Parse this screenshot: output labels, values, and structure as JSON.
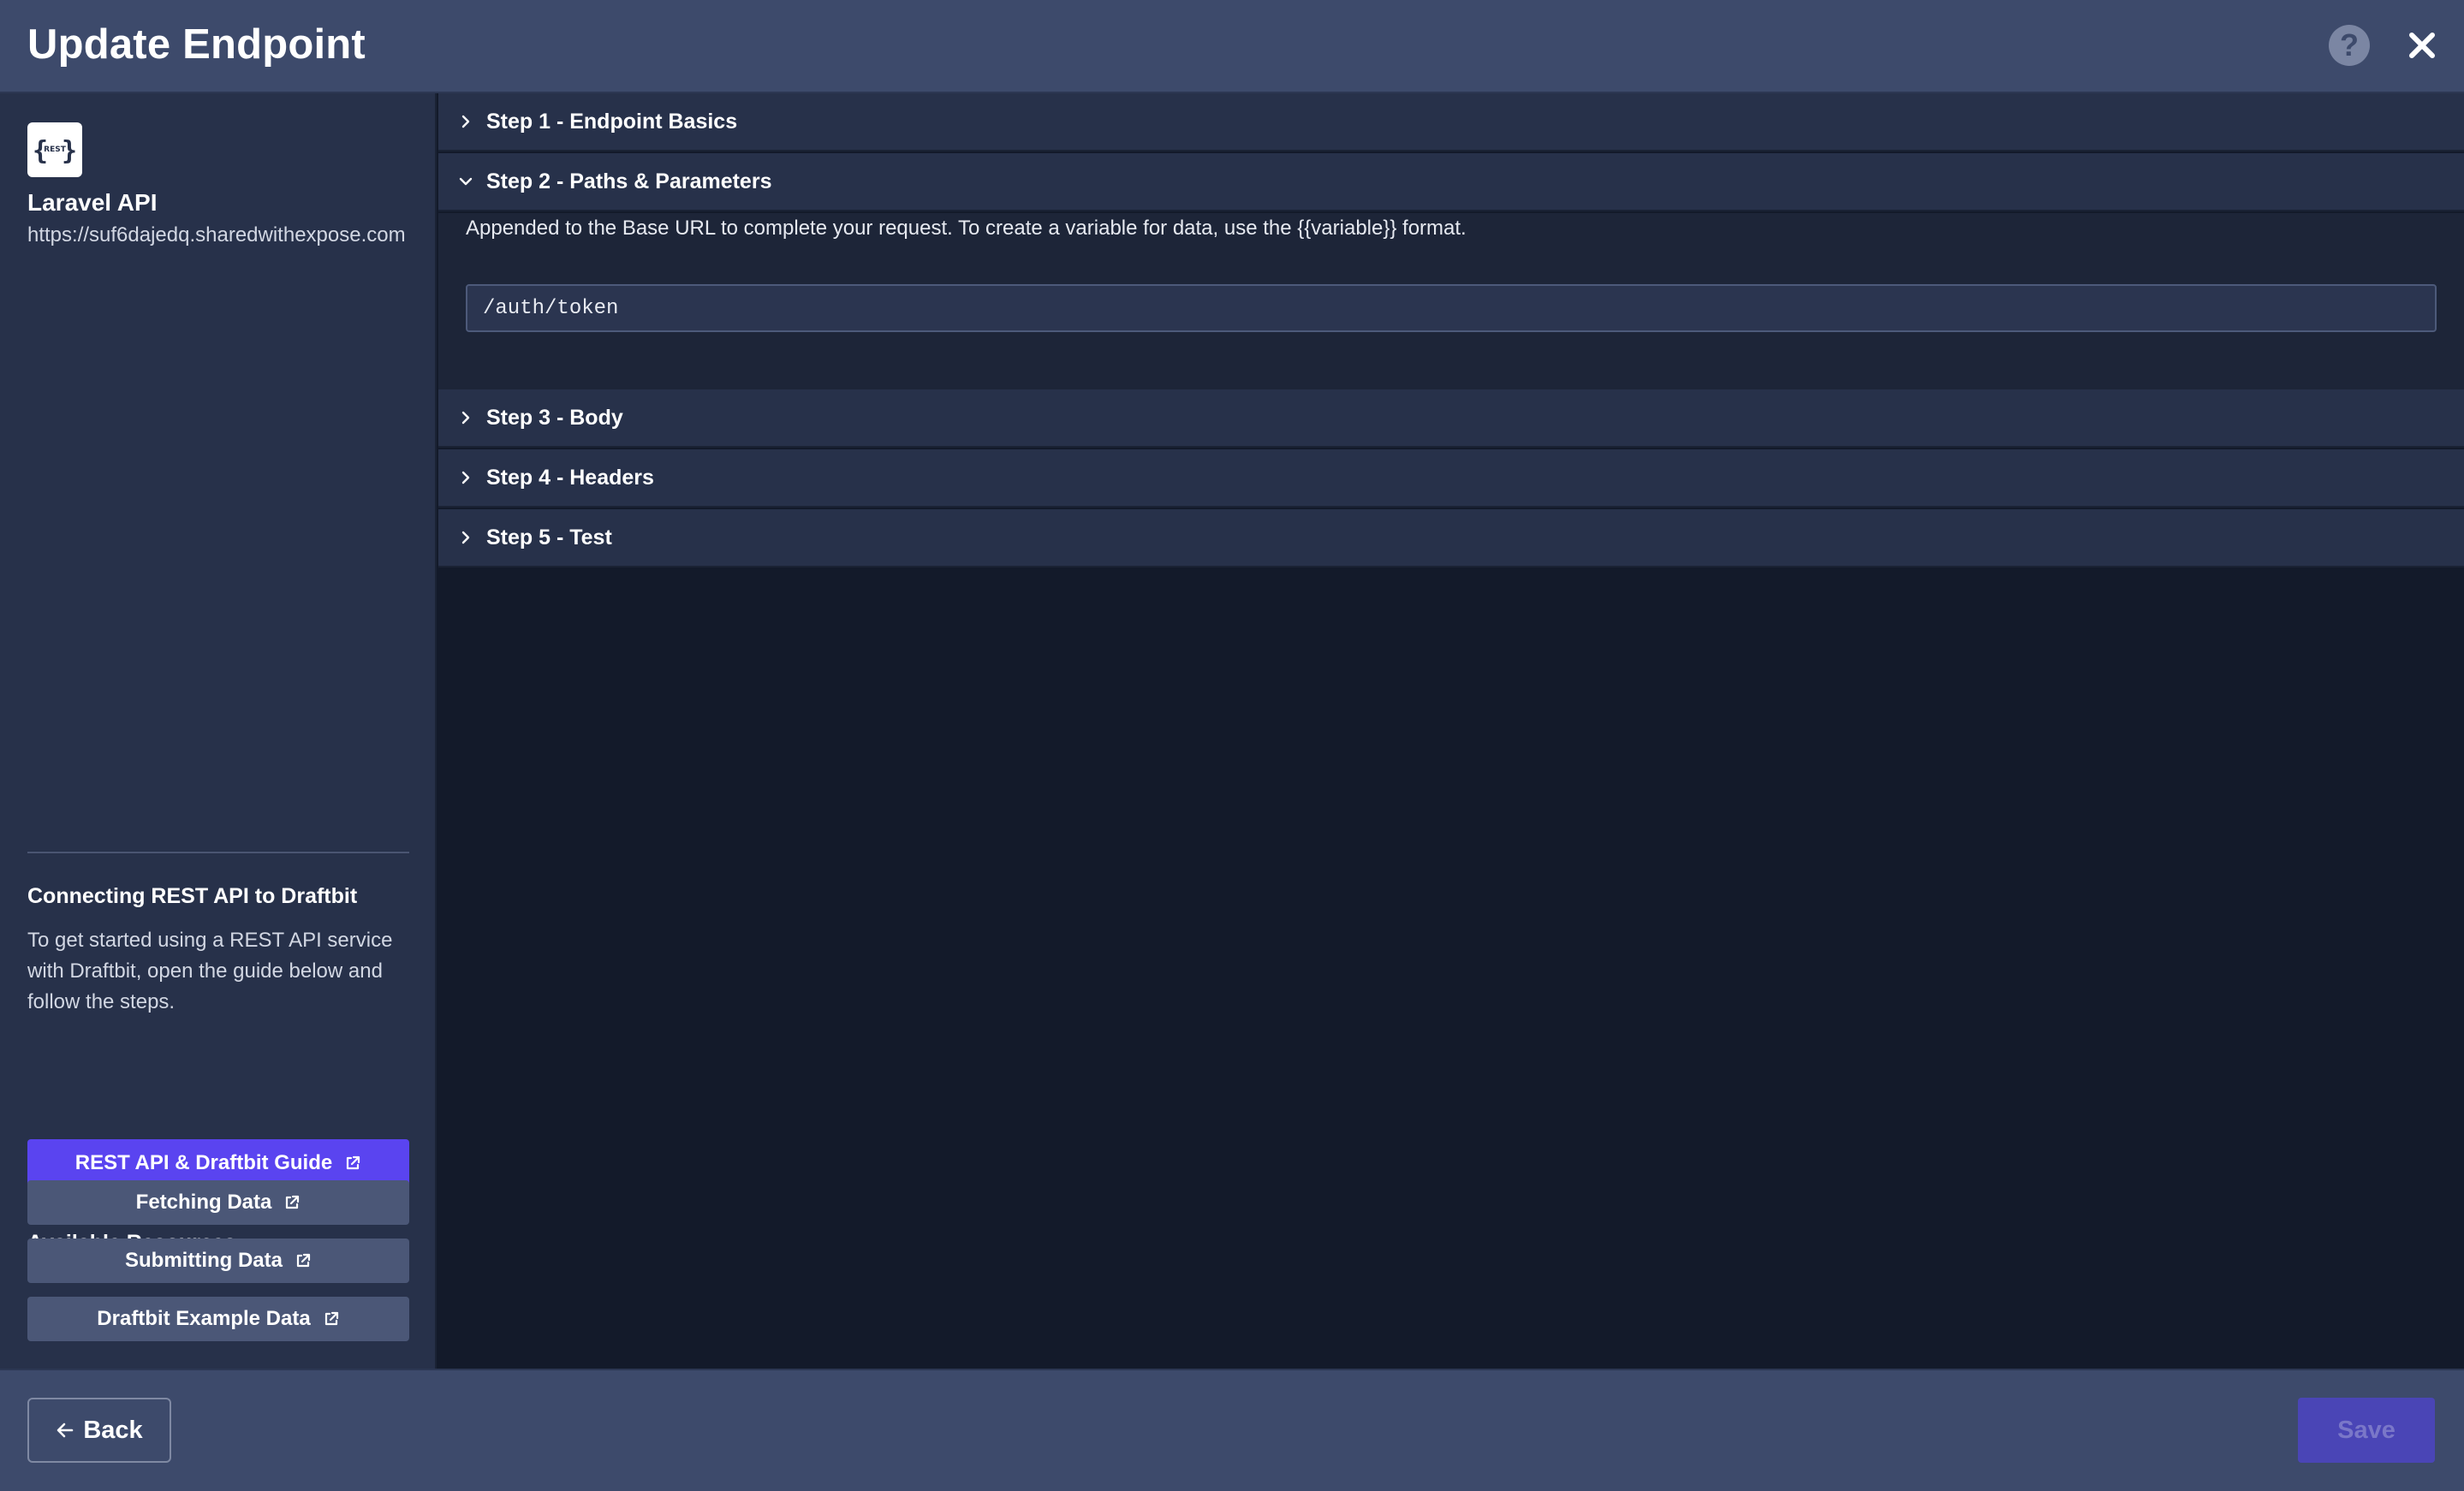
{
  "header": {
    "title": "Update Endpoint",
    "help_icon": "question-circle-icon",
    "help_symbol": "?",
    "close_icon": "close-icon"
  },
  "sidebar": {
    "logo_icon": "rest-logo-icon",
    "logo_text": "REST",
    "api_name": "Laravel API",
    "api_url": "https://suf6dajedq.sharedwithexpose.com",
    "guide_title": "Connecting REST API to Draftbit",
    "guide_text": "To get started using a REST API service with Draftbit, open the guide below and follow the steps.",
    "guide_button_label": "REST API & Draftbit Guide",
    "resources_title": "Available Resources",
    "resources": [
      {
        "label": "Fetching Data"
      },
      {
        "label": "Submitting Data"
      },
      {
        "label": "Draftbit Example Data"
      }
    ]
  },
  "steps": [
    {
      "label": "Step 1 - Endpoint Basics",
      "expanded": false
    },
    {
      "label": "Step 2 - Paths & Parameters",
      "expanded": true
    },
    {
      "label": "Step 3 - Body",
      "expanded": false
    },
    {
      "label": "Step 4 - Headers",
      "expanded": false
    },
    {
      "label": "Step 5 - Test",
      "expanded": false
    }
  ],
  "step2": {
    "description": "Appended to the Base URL to complete your request. To create a variable for data, use the {{variable}} format.",
    "path_value": "/auth/token"
  },
  "footer": {
    "back_label": "Back",
    "save_label": "Save"
  },
  "colors": {
    "accent": "#5a44f0",
    "header_bg": "#3d4a6b",
    "sidebar_bg": "#27314a",
    "main_bg": "#131a2a"
  }
}
